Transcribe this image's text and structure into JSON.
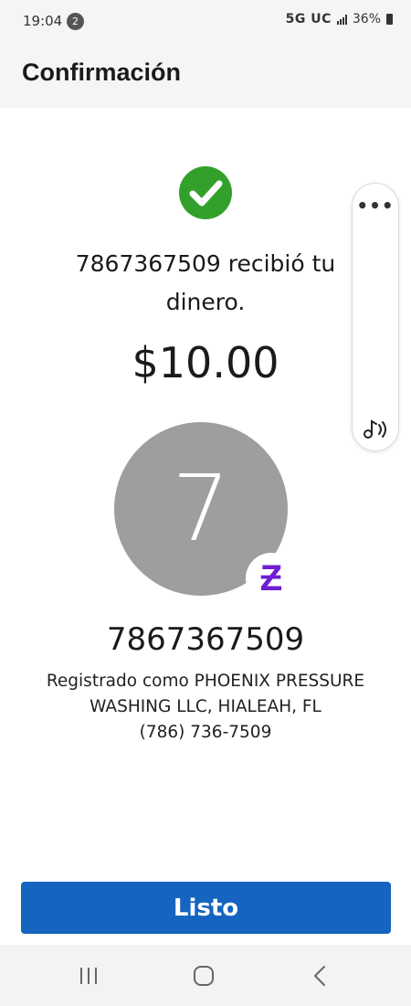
{
  "status_bar": {
    "time": "19:04",
    "notification_count": "2",
    "network": "5G UC",
    "battery": "36%"
  },
  "header": {
    "title": "Confirmación"
  },
  "confirmation": {
    "message": "7867367509 recibió tu dinero.",
    "amount": "$10.00"
  },
  "recipient": {
    "avatar_letter": "7",
    "phone": "7867367509",
    "registered_line1": "Registrado como PHOENIX PRESSURE",
    "registered_line2": "WASHING LLC, HIALEAH, FL",
    "formatted_phone": "(786) 736-7509"
  },
  "actions": {
    "done_label": "Listo"
  },
  "icons": {
    "check": "check-circle-icon",
    "zelle": "zelle-icon",
    "more": "more-horizontal-icon",
    "audio": "audio-icon",
    "nav_recent": "recent-apps-icon",
    "nav_home": "home-icon",
    "nav_back": "back-icon"
  },
  "colors": {
    "success_green": "#34a02c",
    "primary_button": "#1565c0",
    "avatar_gray": "#9e9e9e",
    "zelle_purple": "#6d1ed4"
  }
}
